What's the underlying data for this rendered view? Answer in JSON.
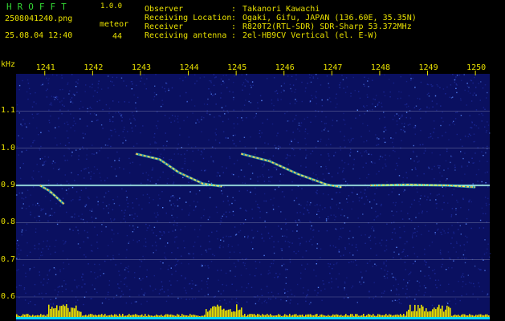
{
  "header": {
    "app_name": "HROFFT",
    "version": "1.0.0",
    "filename": "2508041240.png",
    "datetime": "25.08.04 12:40",
    "meteor_label": "meteor",
    "meteor_count": "44"
  },
  "info": [
    {
      "key": "Observer",
      "value": "Takanori Kawachi"
    },
    {
      "key": "Receiving Location",
      "value": "Ogaki, Gifu, JAPAN (136.60E, 35.35N)"
    },
    {
      "key": "Receiver",
      "value": "R820T2(RTL-SDR) SDR-Sharp 53.372MHz"
    },
    {
      "key": "Receiving antenna",
      "value": "2el-HB9CV Vertical (el. E-W)"
    }
  ],
  "chart_data": {
    "type": "heatmap",
    "title": "",
    "ylabel": "kHz",
    "xlabel": "",
    "x_ticks": [
      "1241",
      "1242",
      "1243",
      "1244",
      "1245",
      "1246",
      "1247",
      "1248",
      "1249",
      "1250"
    ],
    "x_range": [
      1240.4,
      1250.3
    ],
    "y_ticks": [
      "1.1",
      "1.0",
      "0.9",
      "0.8",
      "0.7",
      "0.6"
    ],
    "y_range": [
      0.6,
      1.2
    ],
    "carrier_khz": 0.9,
    "meteor_traces": [
      {
        "points": [
          [
            1240.9,
            0.9
          ],
          [
            1241.1,
            0.885
          ],
          [
            1241.4,
            0.85
          ]
        ]
      },
      {
        "points": [
          [
            1242.9,
            0.985
          ],
          [
            1243.4,
            0.97
          ],
          [
            1243.8,
            0.935
          ],
          [
            1244.3,
            0.905
          ],
          [
            1244.7,
            0.897
          ]
        ]
      },
      {
        "points": [
          [
            1245.1,
            0.985
          ],
          [
            1245.7,
            0.965
          ],
          [
            1246.3,
            0.93
          ],
          [
            1246.9,
            0.902
          ],
          [
            1247.2,
            0.895
          ]
        ]
      },
      {
        "points": [
          [
            1247.8,
            0.9
          ],
          [
            1248.6,
            0.902
          ],
          [
            1249.4,
            0.9
          ],
          [
            1250.0,
            0.895
          ]
        ]
      }
    ],
    "colors": {
      "background": "#0a1060",
      "noise_dim": "#1c2a9a",
      "noise_bright": "#5a8aff",
      "carrier": "#ffffff",
      "trace_hot": "#ff4040",
      "trace_warm": "#ffe84a",
      "trace_cool": "#40ffe0",
      "level_bars": "#e8e000",
      "level_base": "#00d8ff",
      "text": "#e8e000",
      "app_name": "#33d633"
    }
  }
}
